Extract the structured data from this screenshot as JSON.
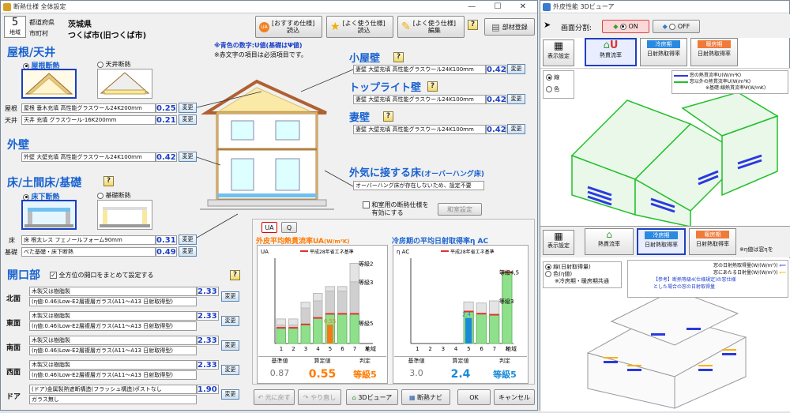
{
  "left_window": {
    "title": "断熱仕様 全体設定",
    "region": {
      "grade_num": "5",
      "grade_label": "地域",
      "pref_label": "都道府県",
      "pref_value": "茨城県",
      "city_label": "市町村",
      "city_value": "つくば市(旧つくば市)"
    },
    "toolbar": {
      "recommend": "[おすすめ仕様]\n読込",
      "frequent_load": "[よく使う仕様]\n読込",
      "frequent_edit": "[よく使う仕様]\n編集",
      "help": "?",
      "parts": "部材登録"
    },
    "notes": {
      "line1": "※青色の数字:U値(基礎はΨ値)",
      "line2": "※赤文字の項目は必須項目です。"
    },
    "roof": {
      "heading": "屋根/天井",
      "opt1": "屋根断熱",
      "opt2": "天井断熱",
      "row1_label": "屋根",
      "row1_text": "屋根 垂木充填 高性能グラスウール24K200mm",
      "row1_value": "0.25",
      "row2_label": "天井",
      "row2_text": "天井 充填 グラスウール-16K200mm",
      "row2_value": "0.21"
    },
    "wall": {
      "heading": "外壁",
      "text": "外壁 大壁充填 高性能グラスウール24K100mm",
      "value": "0.42"
    },
    "floor": {
      "heading": "床/土間床/基礎",
      "opt1": "床下断熱",
      "opt2": "基礎断熱",
      "row1_label": "床",
      "row1_text": "床 根太レス フェノールフォーム90mm",
      "row1_value": "0.31",
      "row2_label": "基礎",
      "row2_text": "べた基礎・床下断熱",
      "row2_value": "0.49"
    },
    "openings": {
      "heading": "開口部",
      "checkbox": "全方位の開口をまとめて設定する",
      "rows": [
        {
          "label": "北面",
          "line1": "木製又は樹脂製",
          "line2": "(η値:0.46)Low-E2層複層ガラス(A11～A13 日射取得型)",
          "value": "2.33"
        },
        {
          "label": "東面",
          "line1": "木製又は樹脂製",
          "line2": "(η値:0.46)Low-E2層複層ガラス(A11～A13 日射取得型)",
          "value": "2.33"
        },
        {
          "label": "南面",
          "line1": "木製又は樹脂製",
          "line2": "(η値:0.46)Low-E2層複層ガラス(A11～A13 日射取得型)",
          "value": "2.33"
        },
        {
          "label": "西面",
          "line1": "木製又は樹脂製",
          "line2": "(η値:0.46)Low-E2層複層ガラス(A11～A13 日射取得型)",
          "value": "2.33"
        },
        {
          "label": "ドア",
          "line1": "(ドア)金属製熱遮断構造(フラッシュ構造)ポストなし",
          "line2": "ガラス無し",
          "value": "1.90"
        }
      ]
    },
    "attic": {
      "heading": "小屋壁",
      "text": "妻壁 大壁充填 高性能グラスウール24K100mm",
      "value": "0.42"
    },
    "toplight": {
      "heading": "トップライト壁",
      "text": "妻壁 大壁充填 高性能グラスウール24K100mm",
      "value": "0.42"
    },
    "gable": {
      "heading": "妻壁",
      "text": "妻壁 大壁充填 高性能グラスウール24K100mm",
      "value": "0.42"
    },
    "overhang": {
      "heading": "外気に接する床",
      "heading_sub": "(オーバーハング床)",
      "text": "オーバーハング床が存在しないため、設定不要"
    },
    "japanese_room": {
      "checkbox": "和室用の断熱仕様を\n有効にする",
      "button": "和室設定"
    },
    "change_label": "変更",
    "chart_tabs": {
      "ua": "UA",
      "q": "Q"
    },
    "charts_panel": {
      "ua_title": "外皮平均熱貫流率UA",
      "ua_unit": "(W/m²K)",
      "eta_title": "冷房期の平均日射取得率η AC",
      "ua_col_std": "基準値",
      "ua_col_calc": "算定値",
      "ua_col_grade": "判定",
      "ua_std": "0.87",
      "ua_calc": "0.55",
      "ua_grade": "等級5",
      "eta_col_std": "基準値",
      "eta_col_calc": "算定値",
      "eta_col_grade": "判定",
      "eta_std": "3.0",
      "eta_calc": "2.4",
      "eta_grade": "等級5"
    },
    "bottom": {
      "undo": "元に戻す",
      "redo": "やり直し",
      "viewer3d": "3Dビューア",
      "navi": "断熱ナビ",
      "ok": "OK",
      "cancel": "キャンセル"
    },
    "colors": {
      "heading": "#1a62d0",
      "value": "#1a3fc8",
      "chart_green": "#8fe08a",
      "chart_orange": "#f27a1a",
      "chart_blue": "#1a8ad8",
      "orange_text": "#ff7a00"
    }
  },
  "right_window": {
    "title": "外皮性能 3Dビューア",
    "split_label": "画面分割:",
    "on": "ON",
    "off": "OFF",
    "top": {
      "display_setting": "表示設定",
      "btn1": "熱貫流率",
      "btn2": "日射熱取得率",
      "btn3": "日射熱取得率",
      "btn1_sub": "U",
      "btn2_sub": "冷房期",
      "btn3_sub": "暖房期",
      "radio1": "線",
      "radio2": "色",
      "legend1": "窓の熱貫流率U(W/m²K)",
      "legend2": "窓以外の熱貫流率U(W/m²K)",
      "legend3": "※基礎:線熱貫流率Ψ(W/mK)"
    },
    "bottom": {
      "display_setting": "表示設定",
      "btn1": "熱貫流率",
      "btn2": "日射熱取得率",
      "btn3": "日射熱取得率",
      "btn2_sub": "冷房期",
      "btn3_sub": "暖房期",
      "note": "※η値は窓ηを",
      "radio1": "線(日射取得量)",
      "radio2": "色(η値)",
      "radio2_note": "※冷房期・暖房期共通",
      "legend1": "窓の日射熱取得量(W/(W/m²))",
      "legend2": "窓にあたる日射量(W/(W/m²))",
      "legend3": "【参考】断熱等級4(仕様規定)の窓仕様",
      "legend4": "とした場合の窓の日射取得量"
    }
  },
  "chart_data": [
    {
      "type": "bar",
      "title": "外皮平均熱貫流率UA",
      "ylabel": "UA",
      "xlabel": "地域",
      "categories": [
        "1",
        "2",
        "3",
        "4",
        "5",
        "6",
        "7",
        "8"
      ],
      "series": [
        {
          "name": "平成28年省エネ基準",
          "values": [
            0.46,
            0.46,
            0.56,
            0.75,
            0.87,
            0.87,
            0.87,
            null
          ]
        },
        {
          "name": "等級5",
          "values": [
            0.4,
            0.4,
            0.5,
            0.6,
            0.6,
            0.6,
            0.6,
            null
          ]
        },
        {
          "name": "等級3",
          "values": [
            0.54,
            0.54,
            1.04,
            1.25,
            1.54,
            1.54,
            1.81,
            null
          ]
        },
        {
          "name": "等級2",
          "values": [
            0.72,
            0.72,
            1.21,
            1.47,
            1.67,
            1.67,
            2.35,
            null
          ]
        },
        {
          "name": "算定値",
          "values": [
            null,
            null,
            null,
            null,
            0.55,
            null,
            null,
            null
          ]
        }
      ],
      "annotations": [
        "0.55"
      ]
    },
    {
      "type": "bar",
      "title": "冷房期の平均日射取得率η AC",
      "ylabel": "η AC",
      "xlabel": "地域",
      "categories": [
        "1",
        "2",
        "3",
        "4",
        "5",
        "6",
        "7",
        "8"
      ],
      "series": [
        {
          "name": "平成28年省エネ基準",
          "values": [
            null,
            null,
            null,
            null,
            3.0,
            2.8,
            2.7,
            6.7
          ]
        },
        {
          "name": "等級4,5",
          "values": [
            null,
            null,
            null,
            null,
            3.0,
            2.8,
            2.7,
            6.7
          ]
        },
        {
          "name": "等級3",
          "values": [
            null,
            null,
            null,
            null,
            3.9,
            3.8,
            4.0,
            null
          ]
        },
        {
          "name": "算定値",
          "values": [
            null,
            null,
            null,
            null,
            2.4,
            null,
            null,
            null
          ]
        }
      ],
      "annotations": [
        "2.4"
      ]
    }
  ]
}
